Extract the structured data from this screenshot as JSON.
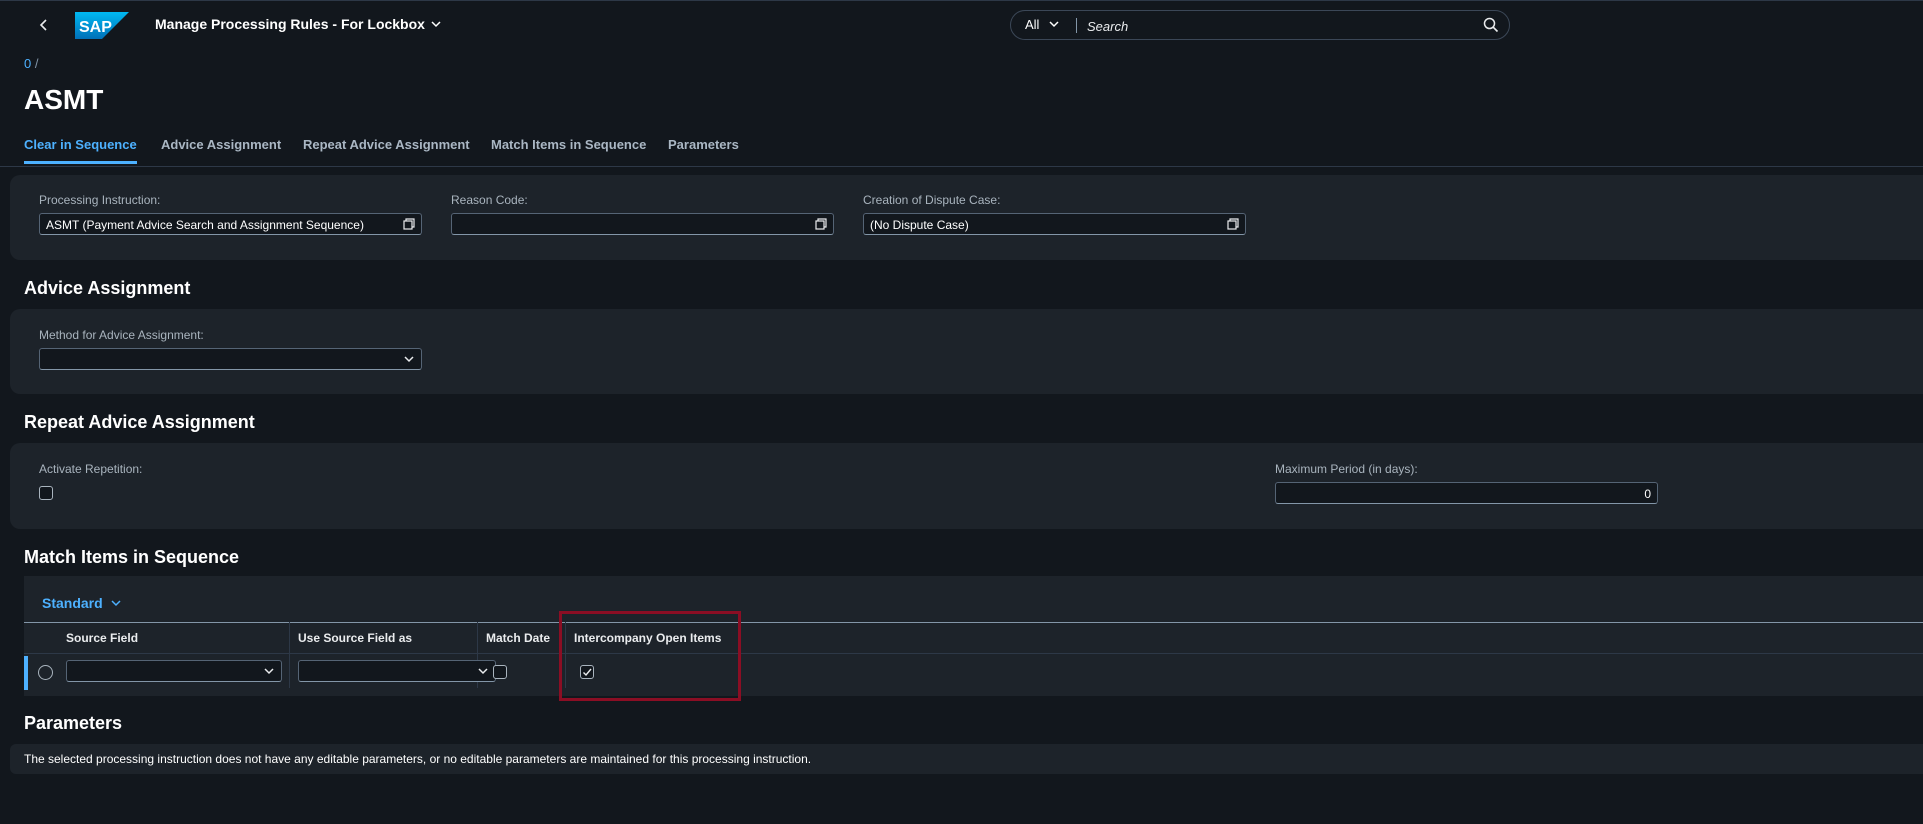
{
  "shell": {
    "back_icon": "chevron-left-icon",
    "logo_text": "SAP",
    "app_title": "Manage Processing Rules - For Lockbox",
    "search_scope": "All",
    "search_placeholder": "Search"
  },
  "breadcrumb": {
    "item": "0",
    "separator": "/"
  },
  "page_title": "ASMT",
  "tabs": [
    {
      "label": "Clear in Sequence",
      "active": true
    },
    {
      "label": "Advice Assignment",
      "active": false
    },
    {
      "label": "Repeat Advice Assignment",
      "active": false
    },
    {
      "label": "Match Items in Sequence",
      "active": false
    },
    {
      "label": "Parameters",
      "active": false
    }
  ],
  "clear_in_sequence": {
    "processing_instruction": {
      "label": "Processing Instruction:",
      "value": "ASMT (Payment Advice Search and Assignment Sequence)"
    },
    "reason_code": {
      "label": "Reason Code:",
      "value": ""
    },
    "dispute_case": {
      "label": "Creation of Dispute Case:",
      "value": "(No Dispute Case)"
    }
  },
  "advice_assignment": {
    "title": "Advice Assignment",
    "method": {
      "label": "Method for Advice Assignment:",
      "value": ""
    }
  },
  "repeat_advice_assignment": {
    "title": "Repeat Advice Assignment",
    "activate": {
      "label": "Activate Repetition:",
      "checked": false
    },
    "max_period": {
      "label": "Maximum Period (in days):",
      "value": "0"
    }
  },
  "match_items": {
    "title": "Match Items in Sequence",
    "variant": "Standard",
    "columns": [
      "Source Field",
      "Use Source Field as",
      "Match Date",
      "Intercompany Open Items"
    ],
    "rows": [
      {
        "source_field": "",
        "use_as": "",
        "match_date": false,
        "intercompany": true
      }
    ]
  },
  "parameters": {
    "title": "Parameters",
    "message": "The selected processing instruction does not have any editable parameters, or no editable parameters are maintained for this processing instruction."
  },
  "colors": {
    "accent": "#4db1ff",
    "background": "#12171d",
    "panel": "#1d232a",
    "highlight": "#8b0e24"
  }
}
